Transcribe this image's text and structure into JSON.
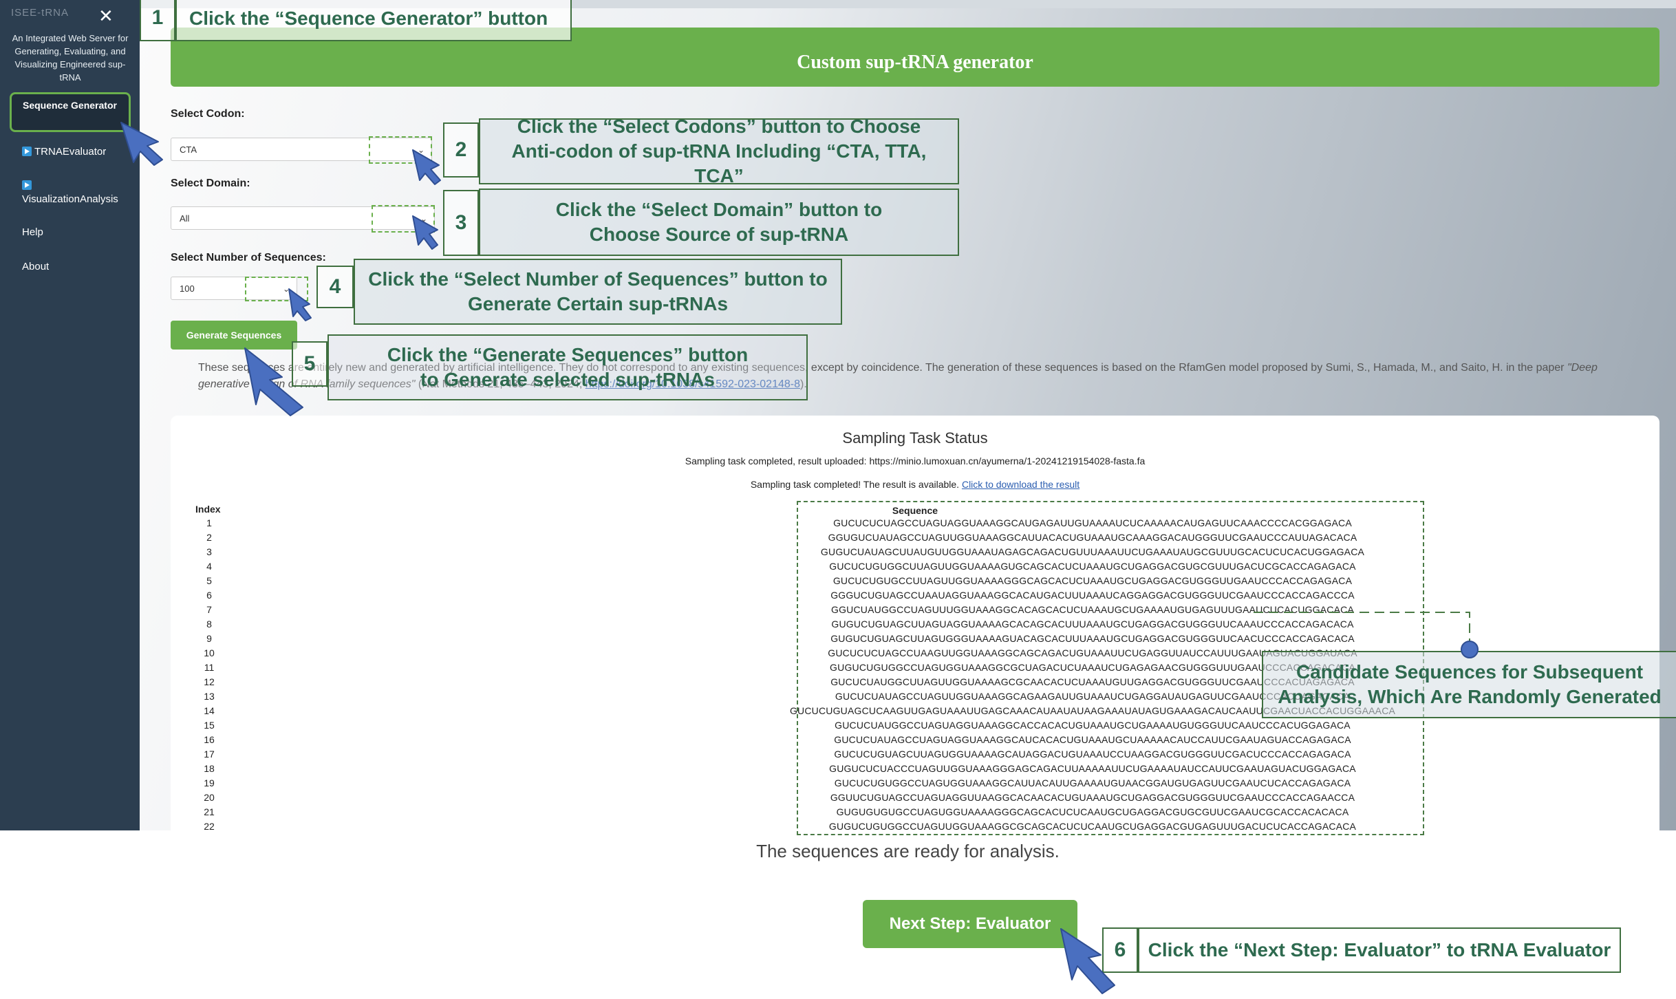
{
  "sidebar": {
    "brand": "ISEE-tRNA",
    "tagline": "An Integrated Web Server for Generating, Evaluating, and Visualizing Engineered sup-tRNA",
    "items": [
      {
        "label": "Sequence Generator"
      },
      {
        "label": "TRNAEvaluator"
      },
      {
        "label": "VisualizationAnalysis"
      },
      {
        "label": "Help"
      },
      {
        "label": "About"
      }
    ]
  },
  "banner": {
    "title": "Custom sup-tRNA generator"
  },
  "form": {
    "codon_label": "Select Codon:",
    "codon_value": "CTA",
    "domain_label": "Select Domain:",
    "domain_value": "All",
    "num_label": "Select Number of Sequences:",
    "num_value": "100",
    "generate_label": "Generate Sequences"
  },
  "disclaimer": {
    "line1": "These sequences are entirely new and generated by artificial intelligence. They do not correspond to any existing sequences, except by coincidence. The generation of these sequences is based on the RfamGen model proposed by Sumi, S., Hamada, M., and Saito, H. in the paper ",
    "paper_title": "\"Deep generative design of RNA family sequences\"",
    "citation": " (Nat Methods 21, 435–443, 2024; ",
    "doi": "https://doi.org/10.1038/s41592-023-02148-8",
    "tail": ")."
  },
  "status": {
    "title": "Sampling Task Status",
    "uploaded": "Sampling task completed, result uploaded: https://minio.lumoxuan.cn/ayumerna/1-20241219154028-fasta.fa",
    "available": "Sampling task completed! The result is available. ",
    "download_link": "Click to download the result",
    "index_header": "Index",
    "sequence_header": "Sequence"
  },
  "sequences": [
    {
      "index": "1",
      "seq": "GUCUCUCUAGCCUAGUAGGUAAAGGCAUGAGAUUGUAAAAUCUCAAAAACAUGAGUUCAAACCCCACGGAGACA"
    },
    {
      "index": "2",
      "seq": "GGUGUCUAUAGCCUAGUUGGUAAAGGCAUUACACUGUAAAUGCAAAGGACAUGGGUUCGAAUCCCAUUAGACACA"
    },
    {
      "index": "3",
      "seq": "GUGUCUAUAGCUUAUGUUGGUAAAUAGAGCAGACUGUUUAAAUUCUGAAAUAUGCGUUUGCACUCUCACUGGAGACA"
    },
    {
      "index": "4",
      "seq": "GUCUCUGUGGCUUAGUUGGUAAAAGUGCAGCACUCUAAAUGCUGAGGACGUGCGUUUGACUCGCACCAGAGACA"
    },
    {
      "index": "5",
      "seq": "GUCUCUGUGCCUUAGUUGGUAAAAGGGCAGCACUCUAAAUGCUGAGGACGUGGGUUGAAUCCCACCAGAGACA"
    },
    {
      "index": "6",
      "seq": "GGGUCUGUAGCCUAAUAGGUAAAGGCACAUGACUUUAAAUCAGGAGGACGUGGGUUCGAAUCCCACCAGACCCA"
    },
    {
      "index": "7",
      "seq": "GGUCUAUGGCCUAGUUUGGUAAAGGCACAGCACUCUAAAUGCUGAAAAUGUGAGUUUGAAUCUCACUGGACACA"
    },
    {
      "index": "8",
      "seq": "GUGUCUGUAGCUUAGUAGGUAAAAGCACAGCACUUUAAAUGCUGAGGACGUGGGUUCAAAUCCCACCAGACACA"
    },
    {
      "index": "9",
      "seq": "GUGUCUGUAGCUUAGUGGGUAAAAGUACAGCACUUUAAAUGCUGAGGACGUGGGUUCAACUCCCACCAGACACA"
    },
    {
      "index": "10",
      "seq": "GUCUCUCUAGCCUAAGUUGGUAAAGGCAGCAGACUGUAAAUUCUGAGGUUAUCCAUUUGAAUAGUACUGGAUACA"
    },
    {
      "index": "11",
      "seq": "GUGUCUGUGGCCUAGUGGUAAAGGCGCUAGACUCUAAAUCUGAGAGAACGUGGGUUUGAAUCCCACCAGACACA"
    },
    {
      "index": "12",
      "seq": "GUCUCUAUGGCUUAGUUGGUAAAAGCGCAACACUCUAAAUGUUGAGGACGUGGGUUCGAAUCCCACUAGAGACA"
    },
    {
      "index": "13",
      "seq": "GUCUCUAUAGCCUAGUUGGUAAAGGCAGAAGAUUGUAAAUCUGAGGAUAUGAGUUCGAAUCCCACUAGAGACA"
    },
    {
      "index": "14",
      "seq": "GUCUCUGUAGCUCAAGUUGAGUAAAUUGAGCAAACAUAAUAUAAGAAAUAUAGUGAAAGACAUCAAUUCGAACUACCACUGGAAACA"
    },
    {
      "index": "15",
      "seq": "GUCUCUAUGGCCUAGUAGGUAAAGGCACCACACUGUAAAUGCUGAAAAUGUGGGUUCAAUCCCACUGGAGACA"
    },
    {
      "index": "16",
      "seq": "GUCUCUAUAGCCUAGUAGGUAAAGGCAUCACACUGUAAAUGCUAAAAACAUCCAUUCGAAUAGUACCAGAGACA"
    },
    {
      "index": "17",
      "seq": "GUCUCUGUAGCUUAGUGGUAAAAGCAUAGGACUGUAAAUCCUAAGGACGUGGGUUCGACUCCCACCAGAGACA"
    },
    {
      "index": "18",
      "seq": "GUGUCUCUACCCUAGUUGGUAAAGGGAGCAGACUUAAAAAUUCUGAAAAUAUCCAUUCGAAUAGUACUGGAGACA"
    },
    {
      "index": "19",
      "seq": "GUCUCUGUGGCCUAGUGGUAAAGGCAUUACAUUGAAAAUGUAACGGAUGUGAGUUCGAAUCUCACCAGAGACA"
    },
    {
      "index": "20",
      "seq": "GGUUCUGUAGCCUAGUAGGUUAAGGCACAACACUGUAAAUGCUGAGGACGUGGGUUCGAAUCCCACCAGAACCA"
    },
    {
      "index": "21",
      "seq": "GUGUGUGUGCCUAGUGGUAAAAGGGCAGCACUCUCAAUGCUGAGGACGUGCGUUCGAAUCGCACCACACACA"
    },
    {
      "index": "22",
      "seq": "GUGUCUGUGGCCUAGUUGGUAAAGGCGCAGCACUCUCAAUGCUGAGGACGUGAGUUUGACUCUCACCAGACACA"
    }
  ],
  "ready_text": "The sequences are ready for analysis.",
  "next_button": "Next Step: Evaluator",
  "callouts": [
    {
      "num": "1",
      "text": "Click the “Sequence Generator” button"
    },
    {
      "num": "2",
      "text": "Click the “Select Codons” button to Choose Anti-codon of sup-tRNA Including “CTA, TTA, TCA”"
    },
    {
      "num": "3",
      "text": "Click the “Select Domain” button to Choose Source of sup-tRNA"
    },
    {
      "num": "4",
      "text": "Click the “Select Number of Sequences” button to Generate Certain sup-tRNAs"
    },
    {
      "num": "5",
      "text": "Click the “Generate Sequences” button to Generate selected sup-tRNAs"
    },
    {
      "num": "6",
      "text": "Click the “Next Step: Evaluator” to tRNA Evaluator"
    }
  ],
  "candidate_note": "Candidate Sequences for Subsequent Analysis, Which Are Randomly Generated",
  "colors": {
    "accent": "#6ab04c",
    "sidebar": "#2c3e50",
    "callout_text": "#2e6a4f",
    "arrow": "#4a6fc0"
  }
}
